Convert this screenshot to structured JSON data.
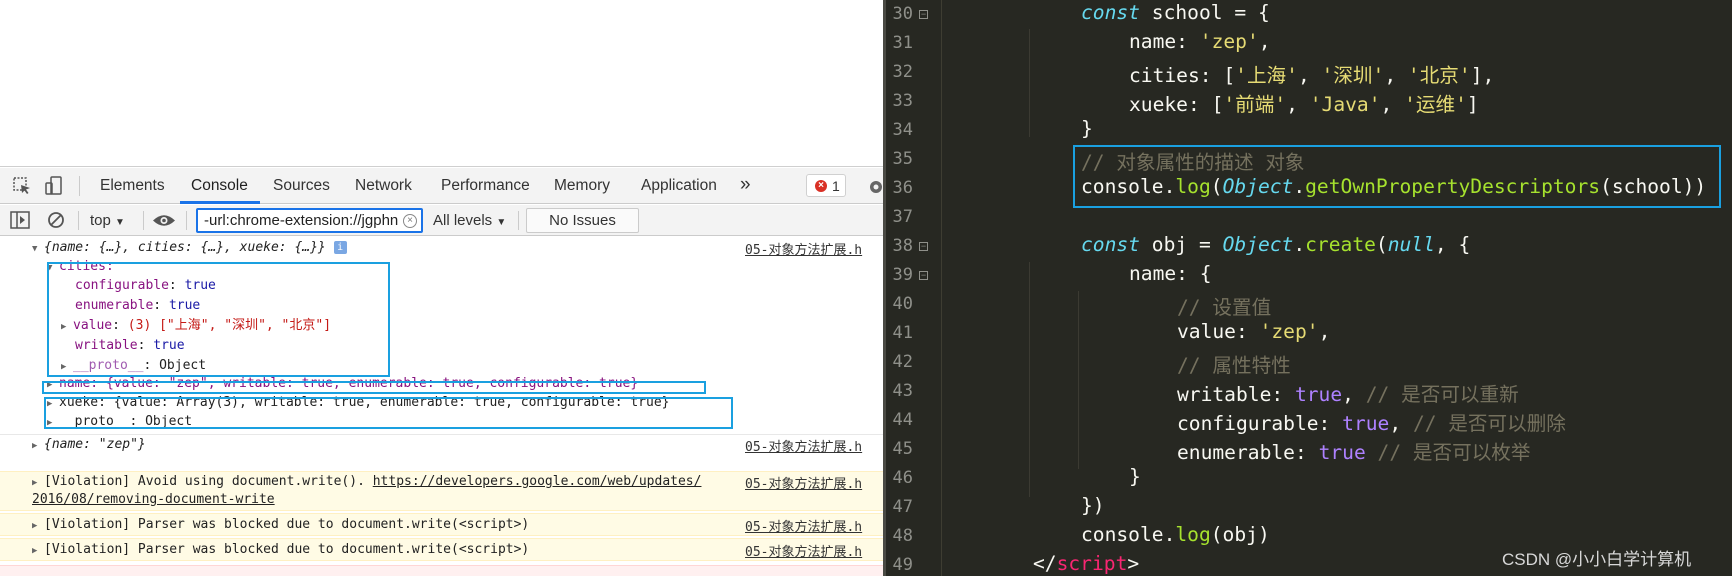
{
  "devtools": {
    "tabs": [
      "Elements",
      "Console",
      "Sources",
      "Network",
      "Performance",
      "Memory",
      "Application"
    ],
    "more_tabs": "»",
    "active_tab": "Console",
    "error_count": "1",
    "toolbar": {
      "context": "top",
      "filter_value": "-url:chrome-extension://jgphn",
      "levels": "All levels",
      "issues": "No Issues"
    }
  },
  "console": {
    "source": "05-对象方法扩展.h",
    "obj1_summary": "{name: {…}, cities: {…}, xueke: {…}}",
    "cities_key": "cities:",
    "cities_props": [
      {
        "key": "configurable",
        "value": "true"
      },
      {
        "key": "enumerable",
        "value": "true"
      },
      {
        "key": "value",
        "value": "(3) [\"上海\", \"深圳\", \"北京\"]"
      },
      {
        "key": "writable",
        "value": "true"
      },
      {
        "key": "__proto__",
        "value": "Object"
      }
    ],
    "name_line": "name: {value: \"zep\", writable: true, enumerable: true, configurable: true}",
    "xueke_line": "xueke: {value: Array(3), writable: true, enumerable: true, configurable: true}",
    "proto_line": "__proto__: Object",
    "obj2_summary": "{name: \"zep\"}",
    "violation1_text": "[Violation] Avoid using document.write(). ",
    "violation1_link_a": "https://developers.google.com/web/updates/",
    "violation1_link_b": "2016/08/removing-document-write",
    "violation2_text": "[Violation] Parser was blocked due to document.write(<script>)",
    "violation3_text": "[Violation] Parser was blocked due to document.write(<script>)"
  },
  "editor": {
    "line_numbers": [
      "30",
      "31",
      "32",
      "33",
      "34",
      "35",
      "36",
      "37",
      "38",
      "39",
      "40",
      "41",
      "42",
      "43",
      "44",
      "45",
      "46",
      "47",
      "48",
      "49"
    ],
    "lines": {
      "l30": {
        "kw": "const",
        "rest": " school = {"
      },
      "l31": {
        "key": "name: ",
        "str": "'zep'",
        "end": ","
      },
      "l32": {
        "key": "cities: [",
        "s1": "'上海'",
        "s2": "'深圳'",
        "s3": "'北京'",
        "end": "],"
      },
      "l33": {
        "key": "xueke: [",
        "s1": "'前端'",
        "s2": "'Java'",
        "s3": "'运维'",
        "end": "]"
      },
      "l34": "}",
      "l35": "// 对象属性的描述 对象",
      "l36": {
        "a": "console.",
        "fn1": "log",
        "b": "(",
        "cls": "Object",
        "c": ".",
        "fn2": "getOwnPropertyDescriptors",
        "d": "(school))"
      },
      "l38": {
        "kw": "const",
        "a": " obj = ",
        "cls": "Object",
        "b": ".",
        "fn": "create",
        "c": "(",
        "null": "null",
        "d": ", {"
      },
      "l39": "name: {",
      "l40": "// 设置值",
      "l41": {
        "key": "value: ",
        "str": "'zep'",
        "end": ","
      },
      "l42": "// 属性特性",
      "l43": {
        "key": "writable: ",
        "val": "true",
        "sep": ", ",
        "cmt": "// 是否可以重新"
      },
      "l44": {
        "key": "configurable: ",
        "val": "true",
        "sep": ", ",
        "cmt": "// 是否可以删除"
      },
      "l45": {
        "key": "enumerable: ",
        "val": "true",
        "sep": " ",
        "cmt": "// 是否可以枚举"
      },
      "l46": "}",
      "l47": "})",
      "l48": {
        "a": "console.",
        "fn": "log",
        "b": "(obj)"
      },
      "l49": {
        "a": "</",
        "tag": "script",
        "b": ">"
      }
    }
  },
  "watermark": "CSDN @小小白学计算机"
}
